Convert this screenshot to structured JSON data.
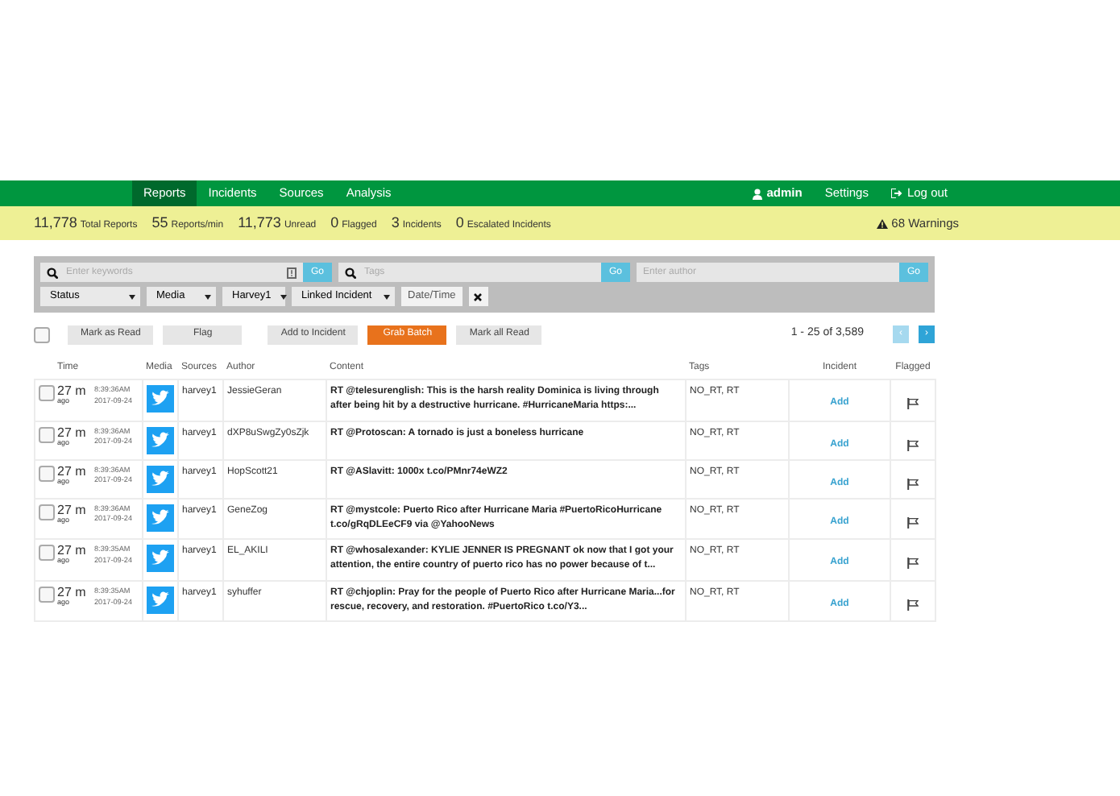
{
  "nav": {
    "items": [
      {
        "label": "Reports",
        "selected": true
      },
      {
        "label": "Incidents",
        "selected": false
      },
      {
        "label": "Sources",
        "selected": false
      },
      {
        "label": "Analysis",
        "selected": false
      }
    ],
    "user": "admin",
    "settings": "Settings",
    "logout": "Log out"
  },
  "stats": [
    {
      "count": "11,778",
      "caption": "Total Reports"
    },
    {
      "count": "55",
      "caption": "Reports/min"
    },
    {
      "count": "11,773",
      "caption": "Unread"
    },
    {
      "count": "0",
      "caption": "Flagged"
    },
    {
      "count": "3",
      "caption": "Incidents"
    },
    {
      "count": "0",
      "caption": "Escalated Incidents"
    }
  ],
  "warnings": "68 Warnings",
  "search_fields": [
    {
      "placeholder": "Enter keywords",
      "kind": "keywords",
      "button": "Go"
    },
    {
      "placeholder": "Tags",
      "kind": "tags",
      "button": "Go"
    },
    {
      "placeholder": "Enter author",
      "kind": "plain",
      "button": "Go"
    }
  ],
  "filters": [
    {
      "label": "Status",
      "kind": "select"
    },
    {
      "label": "Media",
      "kind": "select"
    },
    {
      "label": "Harvey1",
      "kind": "select"
    },
    {
      "label": "Linked Incident",
      "kind": "select"
    },
    {
      "label": "Date/Time",
      "kind": "button"
    },
    {
      "kind": "clear"
    }
  ],
  "toolbar": {
    "select_all": {
      "checked": false
    },
    "buttons": [
      {
        "label": "Mark as Read",
        "kind": "default"
      },
      {
        "label": "Flag",
        "kind": "default"
      },
      {
        "label": "Add to Incident",
        "kind": "default"
      },
      {
        "label": "Grab Batch",
        "kind": "primary"
      },
      {
        "label": "Mark all Read",
        "kind": "default"
      }
    ],
    "range": "1 - 25 of 3,589",
    "pages": [
      {
        "label": "‹",
        "disabled": true
      },
      {
        "label": "›",
        "disabled": false
      }
    ]
  },
  "table": {
    "columns": [
      "Time",
      "Media",
      "Sources",
      "Author",
      "Content",
      "Tags",
      "Incident",
      "Flagged"
    ],
    "rows": [
      {
        "checked": false,
        "age": "27 m",
        "ago": "ago",
        "time": "8:39:36AM",
        "date": "2017-09-24",
        "source": "harvey1",
        "author": "JessieGeran",
        "content": "RT @telesurenglish: This is the harsh reality Dominica is living through after being hit by a destructive hurricane. #HurricaneMaria https:...",
        "tags": "NO_RT, RT",
        "incident": "Add",
        "flagged": false
      },
      {
        "checked": false,
        "age": "27 m",
        "ago": "ago",
        "time": "8:39:36AM",
        "date": "2017-09-24",
        "source": "harvey1",
        "author": "dXP8uSwgZy0sZjk",
        "content": "RT @Protoscan: A tornado is just a boneless hurricane",
        "tags": "NO_RT, RT",
        "incident": "Add",
        "flagged": false
      },
      {
        "checked": false,
        "age": "27 m",
        "ago": "ago",
        "time": "8:39:36AM",
        "date": "2017-09-24",
        "source": "harvey1",
        "author": "HopScott21",
        "content": "RT @ASlavitt: 1000x t.co/PMnr74eWZ2",
        "tags": "NO_RT, RT",
        "incident": "Add",
        "flagged": false
      },
      {
        "checked": false,
        "age": "27 m",
        "ago": "ago",
        "time": "8:39:36AM",
        "date": "2017-09-24",
        "source": "harvey1",
        "author": "GeneZog",
        "content": "RT @mystcole: Puerto Rico after Hurricane Maria #PuertoRicoHurricane t.co/gRqDLEeCF9 via @YahooNews",
        "tags": "NO_RT, RT",
        "incident": "Add",
        "flagged": false
      },
      {
        "checked": false,
        "age": "27 m",
        "ago": "ago",
        "time": "8:39:35AM",
        "date": "2017-09-24",
        "source": "harvey1",
        "author": "EL_AKILI",
        "content": "RT @whosalexander: KYLIE JENNER IS PREGNANT ok now that I got your attention, the entire country of puerto rico has no power because of t...",
        "tags": "NO_RT, RT",
        "incident": "Add",
        "flagged": false
      },
      {
        "checked": false,
        "age": "27 m",
        "ago": "ago",
        "time": "8:39:35AM",
        "date": "2017-09-24",
        "source": "harvey1",
        "author": "syhuffer",
        "content": "RT @chjoplin: Pray for the people of Puerto Rico after Hurricane Maria...for rescue, recovery, and restoration. #PuertoRico t.co/Y3...",
        "tags": "NO_RT, RT",
        "incident": "Add",
        "flagged": false
      }
    ]
  }
}
